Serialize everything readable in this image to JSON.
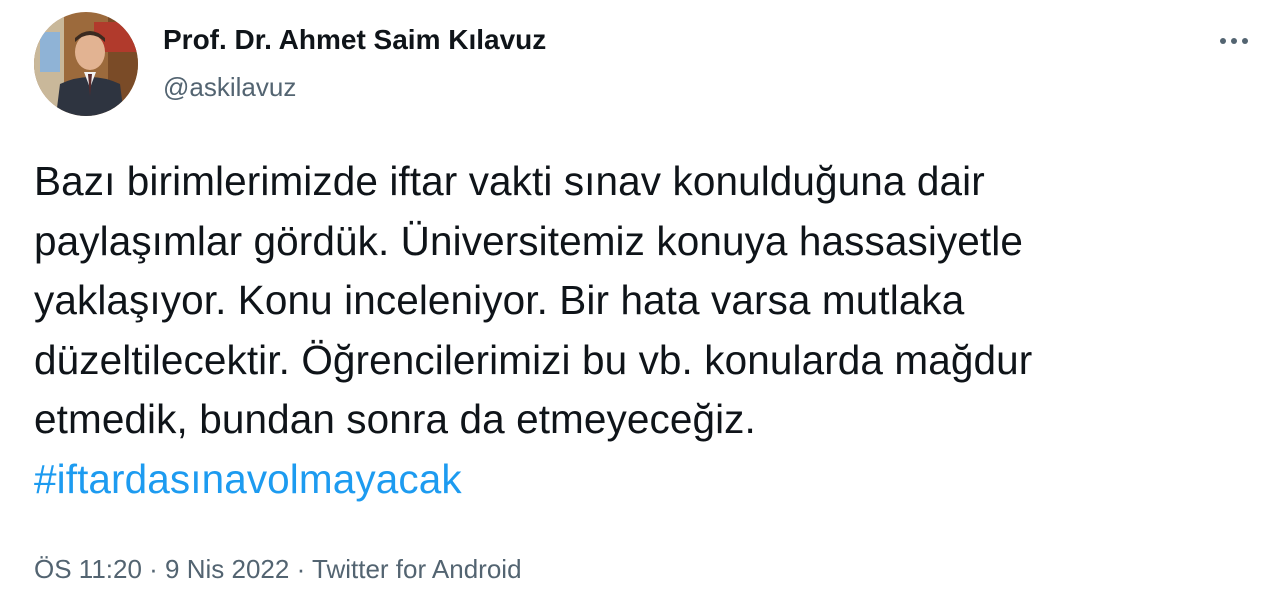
{
  "author": {
    "display_name": "Prof. Dr. Ahmet Saim Kılavuz",
    "handle": "@askilavuz",
    "avatar": "profile-photo"
  },
  "more_icon": "more-horizontal-icon",
  "tweet": {
    "lines": [
      "Bazı birimlerimizde iftar vakti sınav konulduğuna dair",
      "paylaşımlar gördük. Üniversitemiz konuya hassasiyetle",
      "yaklaşıyor. Konu inceleniyor. Bir hata varsa mutlaka",
      "düzeltilecektir. Öğrencilerimizi bu vb. konularda mağdur",
      "etmedik, bundan sonra da etmeyeceğiz."
    ],
    "hashtag": "#iftardasınavolmayacak"
  },
  "meta": {
    "time": "ÖS 11:20",
    "separator1": " · ",
    "date": "9 Nis 2022",
    "separator2": " · ",
    "source": "Twitter for Android"
  },
  "colors": {
    "text": "#0f1419",
    "secondary": "#536471",
    "link": "#1d9bf0"
  }
}
